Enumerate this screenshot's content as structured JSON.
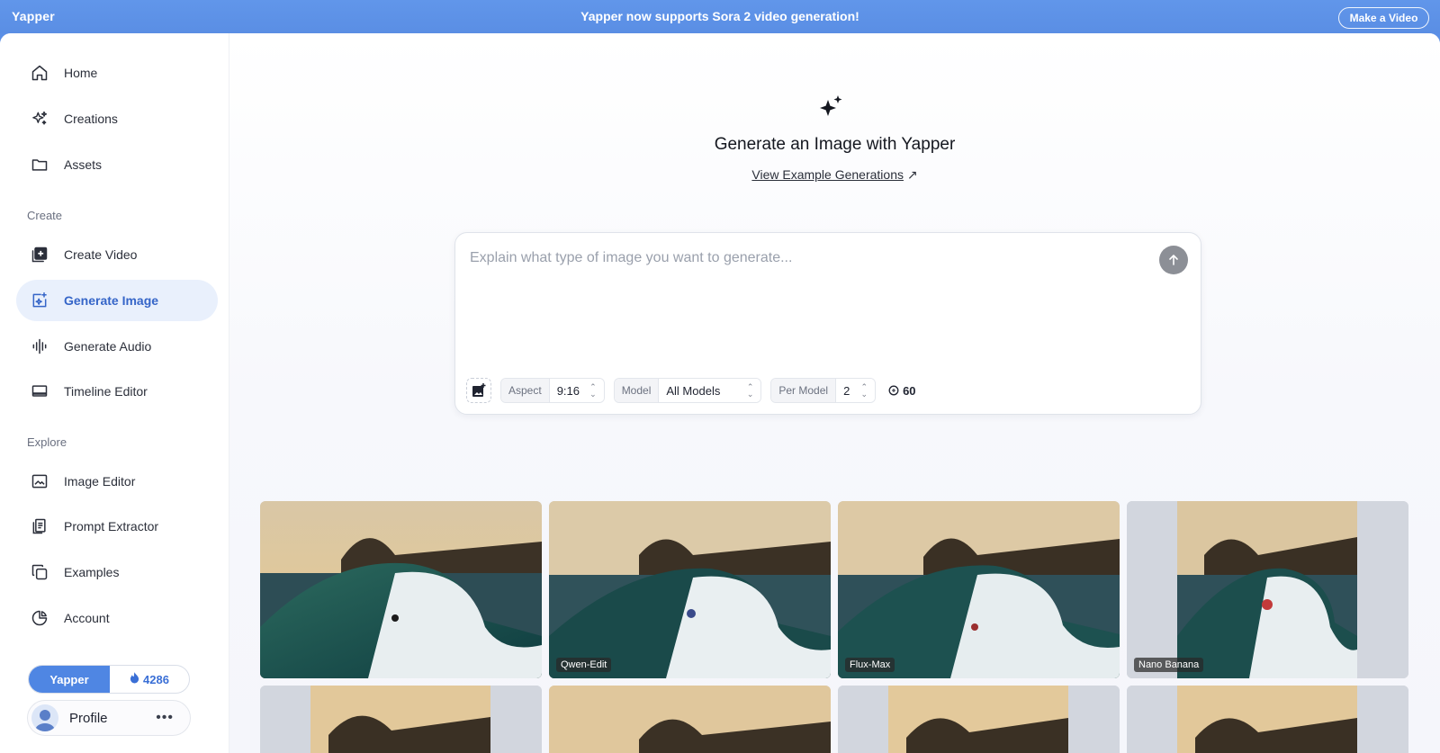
{
  "banner": {
    "brand": "Yapper",
    "announcement_prefix": "Yapper now supports ",
    "announcement_strong": "Sora 2",
    "announcement_suffix": " video generation!",
    "cta": "Make a Video"
  },
  "sidebar": {
    "items_top": [
      {
        "label": "Home",
        "icon": "home-icon"
      },
      {
        "label": "Creations",
        "icon": "sparkles-icon"
      },
      {
        "label": "Assets",
        "icon": "folder-icon"
      }
    ],
    "section_create": "Create",
    "items_create": [
      {
        "label": "Create Video",
        "icon": "video-plus-icon"
      },
      {
        "label": "Generate Image",
        "icon": "image-sparkle-icon",
        "active": true
      },
      {
        "label": "Generate Audio",
        "icon": "waveform-icon"
      },
      {
        "label": "Timeline Editor",
        "icon": "monitor-icon"
      }
    ],
    "section_explore": "Explore",
    "items_explore": [
      {
        "label": "Image Editor",
        "icon": "image-edit-icon"
      },
      {
        "label": "Prompt Extractor",
        "icon": "document-icon"
      },
      {
        "label": "Examples",
        "icon": "copy-icon"
      },
      {
        "label": "Account",
        "icon": "pie-chart-icon"
      }
    ],
    "plan": "Yapper",
    "credits": "4286",
    "profile_name": "Profile"
  },
  "hero": {
    "title": "Generate an Image with Yapper",
    "link": "View Example Generations",
    "link_arrow": "↗"
  },
  "prompt": {
    "placeholder": "Explain what type of image you want to generate...",
    "aspect_label": "Aspect",
    "aspect_value": "9:16",
    "model_label": "Model",
    "model_value": "All Models",
    "per_model_label": "Per Model",
    "per_model_value": "2",
    "cost": "60"
  },
  "gallery": {
    "row1": [
      {
        "label": ""
      },
      {
        "label": "Qwen-Edit"
      },
      {
        "label": "Flux-Max"
      },
      {
        "label": "Nano Banana"
      }
    ]
  },
  "colors": {
    "accent": "#4f86e3",
    "banner": "#5b8fe6",
    "active_bg": "#e9f0fc",
    "active_text": "#3565c8"
  }
}
